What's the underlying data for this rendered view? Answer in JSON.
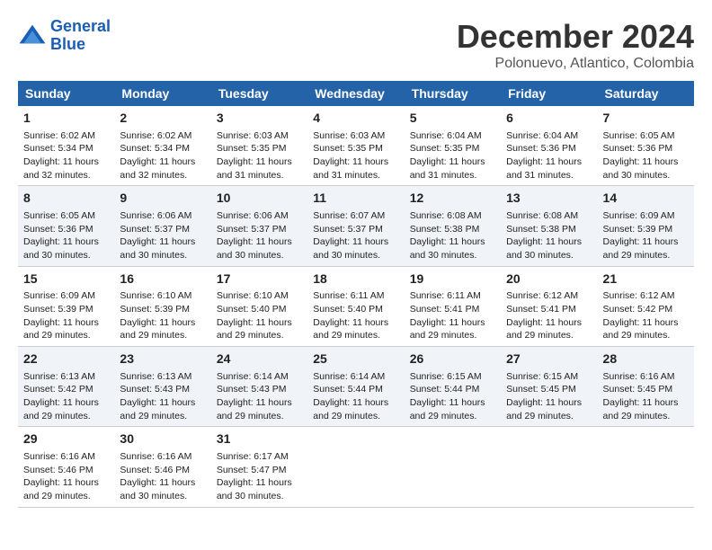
{
  "logo": {
    "line1": "General",
    "line2": "Blue"
  },
  "title": "December 2024",
  "subtitle": "Polonuevo, Atlantico, Colombia",
  "days_of_week": [
    "Sunday",
    "Monday",
    "Tuesday",
    "Wednesday",
    "Thursday",
    "Friday",
    "Saturday"
  ],
  "weeks": [
    [
      {
        "day": 1,
        "sunrise": "6:02 AM",
        "sunset": "5:34 PM",
        "daylight": "11 hours and 32 minutes."
      },
      {
        "day": 2,
        "sunrise": "6:02 AM",
        "sunset": "5:34 PM",
        "daylight": "11 hours and 32 minutes."
      },
      {
        "day": 3,
        "sunrise": "6:03 AM",
        "sunset": "5:35 PM",
        "daylight": "11 hours and 31 minutes."
      },
      {
        "day": 4,
        "sunrise": "6:03 AM",
        "sunset": "5:35 PM",
        "daylight": "11 hours and 31 minutes."
      },
      {
        "day": 5,
        "sunrise": "6:04 AM",
        "sunset": "5:35 PM",
        "daylight": "11 hours and 31 minutes."
      },
      {
        "day": 6,
        "sunrise": "6:04 AM",
        "sunset": "5:36 PM",
        "daylight": "11 hours and 31 minutes."
      },
      {
        "day": 7,
        "sunrise": "6:05 AM",
        "sunset": "5:36 PM",
        "daylight": "11 hours and 30 minutes."
      }
    ],
    [
      {
        "day": 8,
        "sunrise": "6:05 AM",
        "sunset": "5:36 PM",
        "daylight": "11 hours and 30 minutes."
      },
      {
        "day": 9,
        "sunrise": "6:06 AM",
        "sunset": "5:37 PM",
        "daylight": "11 hours and 30 minutes."
      },
      {
        "day": 10,
        "sunrise": "6:06 AM",
        "sunset": "5:37 PM",
        "daylight": "11 hours and 30 minutes."
      },
      {
        "day": 11,
        "sunrise": "6:07 AM",
        "sunset": "5:37 PM",
        "daylight": "11 hours and 30 minutes."
      },
      {
        "day": 12,
        "sunrise": "6:08 AM",
        "sunset": "5:38 PM",
        "daylight": "11 hours and 30 minutes."
      },
      {
        "day": 13,
        "sunrise": "6:08 AM",
        "sunset": "5:38 PM",
        "daylight": "11 hours and 30 minutes."
      },
      {
        "day": 14,
        "sunrise": "6:09 AM",
        "sunset": "5:39 PM",
        "daylight": "11 hours and 29 minutes."
      }
    ],
    [
      {
        "day": 15,
        "sunrise": "6:09 AM",
        "sunset": "5:39 PM",
        "daylight": "11 hours and 29 minutes."
      },
      {
        "day": 16,
        "sunrise": "6:10 AM",
        "sunset": "5:39 PM",
        "daylight": "11 hours and 29 minutes."
      },
      {
        "day": 17,
        "sunrise": "6:10 AM",
        "sunset": "5:40 PM",
        "daylight": "11 hours and 29 minutes."
      },
      {
        "day": 18,
        "sunrise": "6:11 AM",
        "sunset": "5:40 PM",
        "daylight": "11 hours and 29 minutes."
      },
      {
        "day": 19,
        "sunrise": "6:11 AM",
        "sunset": "5:41 PM",
        "daylight": "11 hours and 29 minutes."
      },
      {
        "day": 20,
        "sunrise": "6:12 AM",
        "sunset": "5:41 PM",
        "daylight": "11 hours and 29 minutes."
      },
      {
        "day": 21,
        "sunrise": "6:12 AM",
        "sunset": "5:42 PM",
        "daylight": "11 hours and 29 minutes."
      }
    ],
    [
      {
        "day": 22,
        "sunrise": "6:13 AM",
        "sunset": "5:42 PM",
        "daylight": "11 hours and 29 minutes."
      },
      {
        "day": 23,
        "sunrise": "6:13 AM",
        "sunset": "5:43 PM",
        "daylight": "11 hours and 29 minutes."
      },
      {
        "day": 24,
        "sunrise": "6:14 AM",
        "sunset": "5:43 PM",
        "daylight": "11 hours and 29 minutes."
      },
      {
        "day": 25,
        "sunrise": "6:14 AM",
        "sunset": "5:44 PM",
        "daylight": "11 hours and 29 minutes."
      },
      {
        "day": 26,
        "sunrise": "6:15 AM",
        "sunset": "5:44 PM",
        "daylight": "11 hours and 29 minutes."
      },
      {
        "day": 27,
        "sunrise": "6:15 AM",
        "sunset": "5:45 PM",
        "daylight": "11 hours and 29 minutes."
      },
      {
        "day": 28,
        "sunrise": "6:16 AM",
        "sunset": "5:45 PM",
        "daylight": "11 hours and 29 minutes."
      }
    ],
    [
      {
        "day": 29,
        "sunrise": "6:16 AM",
        "sunset": "5:46 PM",
        "daylight": "11 hours and 29 minutes."
      },
      {
        "day": 30,
        "sunrise": "6:16 AM",
        "sunset": "5:46 PM",
        "daylight": "11 hours and 30 minutes."
      },
      {
        "day": 31,
        "sunrise": "6:17 AM",
        "sunset": "5:47 PM",
        "daylight": "11 hours and 30 minutes."
      },
      null,
      null,
      null,
      null
    ]
  ]
}
